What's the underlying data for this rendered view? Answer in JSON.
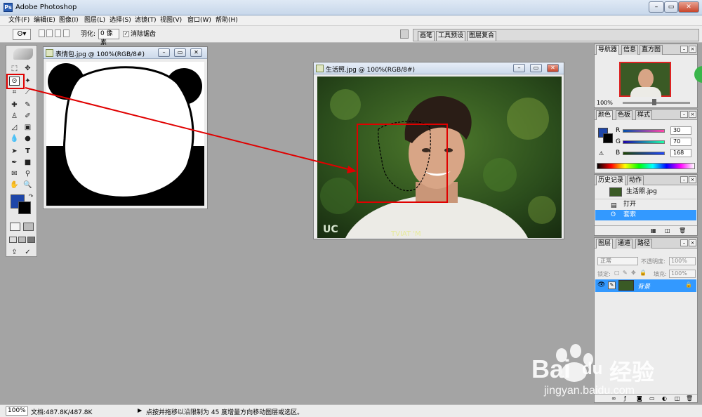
{
  "app": {
    "title": "Adobe Photoshop"
  },
  "menu": [
    "文件(F)",
    "编辑(E)",
    "图像(I)",
    "图层(L)",
    "选择(S)",
    "滤镜(T)",
    "视图(V)",
    "窗口(W)",
    "帮助(H)"
  ],
  "options": {
    "feather_label": "羽化:",
    "feather_value": "0 像素",
    "antialias_label": "消除锯齿",
    "antialias_checked": "✓"
  },
  "palette_well": {
    "tabs": [
      "画笔",
      "工具预设",
      "图层复合"
    ]
  },
  "doc1": {
    "title": "表情包.jpg @ 100%(RGB/8#)"
  },
  "doc2": {
    "title": "生活照.jpg @ 100%(RGB/8#)",
    "shirt_text": "TVIAT 'M",
    "watermark": "UC"
  },
  "navigator": {
    "tabs": [
      "导航器",
      "信息",
      "直方图"
    ],
    "zoom": "100%"
  },
  "color": {
    "tabs": [
      "颜色",
      "色板",
      "样式"
    ],
    "channels": [
      {
        "name": "R",
        "value": "30"
      },
      {
        "name": "G",
        "value": "70"
      },
      {
        "name": "B",
        "value": "168"
      }
    ],
    "fg_color": "#1e46a8",
    "bg_color": "#000000"
  },
  "history": {
    "tabs": [
      "历史记录",
      "动作"
    ],
    "snapshot": "生活照.jpg",
    "items": [
      "打开",
      "套索"
    ]
  },
  "layers": {
    "tabs": [
      "图层",
      "通道",
      "路径"
    ],
    "blend_mode": "正常",
    "opacity_label": "不透明度:",
    "opacity_value": "100%",
    "lock_label": "锁定:",
    "fill_label": "填充:",
    "fill_value": "100%",
    "layer_name": "背景"
  },
  "status": {
    "zoom": "100%",
    "doc_size": "文档:487.8K/487.8K",
    "hint": "点按并拖移以沿限制为 45 度增量方向移动图层或选区。"
  },
  "watermark": {
    "brand_latin": "Bai",
    "brand_cn": "经验",
    "brand_du": "du",
    "url": "jingyan.baidu.com"
  },
  "colors": {
    "annotation_red": "#e00000",
    "selection_blue": "#3399ff",
    "fg": "#1e46a8"
  }
}
